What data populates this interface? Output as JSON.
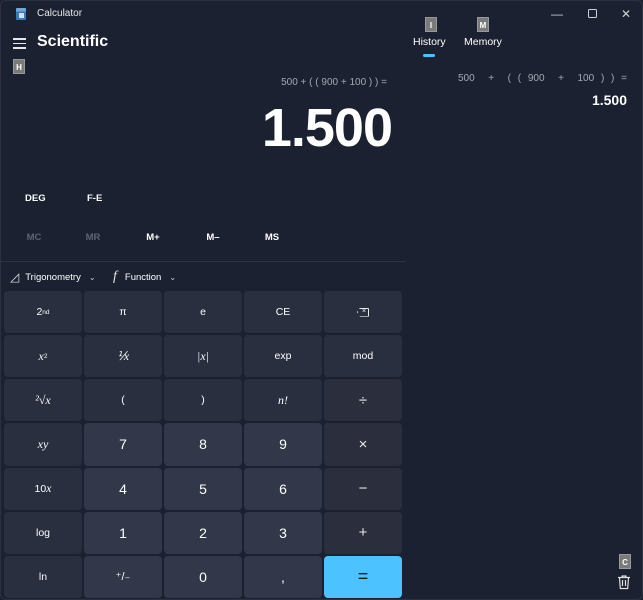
{
  "window": {
    "app_title": "Calculator",
    "minimize_glyph": "—",
    "close_glyph": "✕"
  },
  "header": {
    "mode_title": "Scientific",
    "keytips": {
      "hamburger": "H",
      "history": "I",
      "memory": "M",
      "clear_history": "C"
    }
  },
  "display": {
    "expression": "500 + ( ( 900 + 100 ) ) =",
    "result": "1.500"
  },
  "mode_row": {
    "angle_unit": "DEG",
    "notation": "F-E"
  },
  "memory_row": {
    "mc": "MC",
    "mr": "MR",
    "mplus": "M+",
    "mminus": "M–",
    "ms": "MS"
  },
  "dropdowns": {
    "trigonometry": {
      "icon": "triangle-ruler-icon",
      "glyph": "◿",
      "label": "Trigonometry"
    },
    "function": {
      "icon": "function-icon",
      "glyph": "f",
      "label": "Function"
    },
    "chevron": "⌄"
  },
  "keypad": {
    "row1": {
      "second": "2",
      "second_sup": "nd",
      "pi": "π",
      "e": "e",
      "ce": "CE",
      "backspace": "×"
    },
    "row2": {
      "x_squared": "x",
      "x_squared_sup": "2",
      "reciprocal": "⅟x",
      "abs": "|x|",
      "exp": "exp",
      "mod": "mod"
    },
    "row3": {
      "root": "²√x",
      "open_paren": "(",
      "close_paren": ")",
      "factorial": "n!",
      "divide": "÷"
    },
    "row4": {
      "x_power": "x",
      "x_power_sup": "y",
      "seven": "7",
      "eight": "8",
      "nine": "9",
      "multiply": "×"
    },
    "row5": {
      "ten_power": "10",
      "ten_power_sup": "x",
      "four": "4",
      "five": "5",
      "six": "6",
      "minus": "−"
    },
    "row6": {
      "log": "log",
      "one": "1",
      "two": "2",
      "three": "3",
      "plus": "+"
    },
    "row7": {
      "ln": "ln",
      "negate": "⁺/₋",
      "zero": "0",
      "decimal": ",",
      "equals": "="
    }
  },
  "side_panel": {
    "tabs": [
      {
        "label": "History",
        "active": true
      },
      {
        "label": "Memory",
        "active": false
      }
    ],
    "history": [
      {
        "expression": "500  +  ( ( 900  +  100 ) ) =",
        "result": "1.500"
      }
    ]
  },
  "colors": {
    "accent": "#4cc2ff",
    "background": "#1c2131",
    "key": "#2c3144",
    "number_key": "#323749"
  }
}
